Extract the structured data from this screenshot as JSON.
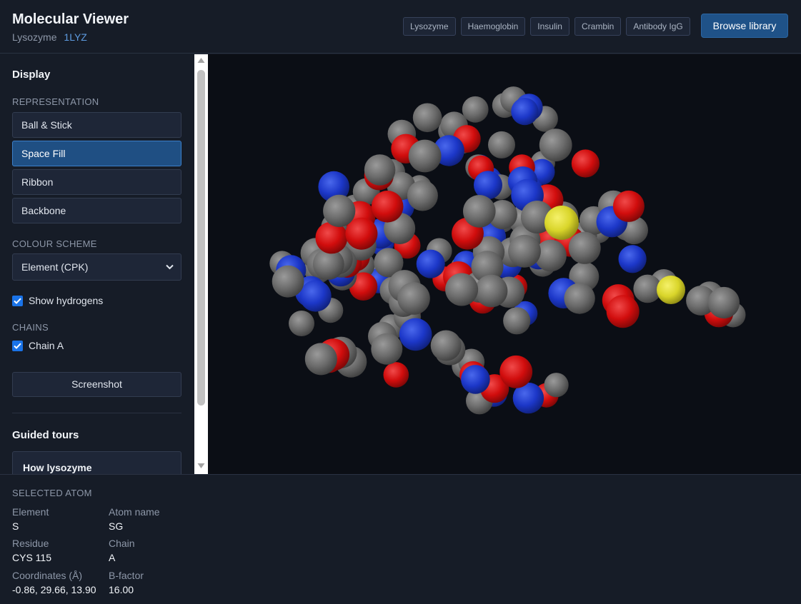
{
  "header": {
    "title": "Molecular Viewer",
    "molecule_name": "Lysozyme",
    "pdb_code": "1LYZ",
    "presets": [
      "Lysozyme",
      "Haemoglobin",
      "Insulin",
      "Crambin",
      "Antibody IgG"
    ],
    "browse_label": "Browse library"
  },
  "sidebar": {
    "display_heading": "Display",
    "representation_label": "REPRESENTATION",
    "representations": [
      "Ball & Stick",
      "Space Fill",
      "Ribbon",
      "Backbone"
    ],
    "active_representation": "Space Fill",
    "colour_scheme_label": "COLOUR SCHEME",
    "colour_scheme_value": "Element (CPK)",
    "show_hydrogens_label": "Show hydrogens",
    "show_hydrogens_checked": true,
    "chains_label": "CHAINS",
    "chain_a_label": "Chain A",
    "chain_a_checked": true,
    "screenshot_label": "Screenshot",
    "guided_tours_heading": "Guided tours",
    "tour_title": "How lysozyme"
  },
  "colors": {
    "accent": "#1f5288",
    "carbon": "#6b6b6b",
    "oxygen": "#d10d0d",
    "nitrogen": "#1c37c8",
    "sulfur": "#d9d52a",
    "viewport_bg": "#0b0e15"
  },
  "selected_atom": {
    "heading": "SELECTED ATOM",
    "element_label": "Element",
    "element": "S",
    "atom_name_label": "Atom name",
    "atom_name": "SG",
    "residue_label": "Residue",
    "residue": "CYS 115",
    "chain_label": "Chain",
    "chain": "A",
    "coordinates_label": "Coordinates (Å)",
    "coordinates": "-0.86, 29.66, 13.90",
    "bfactor_label": "B-factor",
    "bfactor": "16.00"
  }
}
